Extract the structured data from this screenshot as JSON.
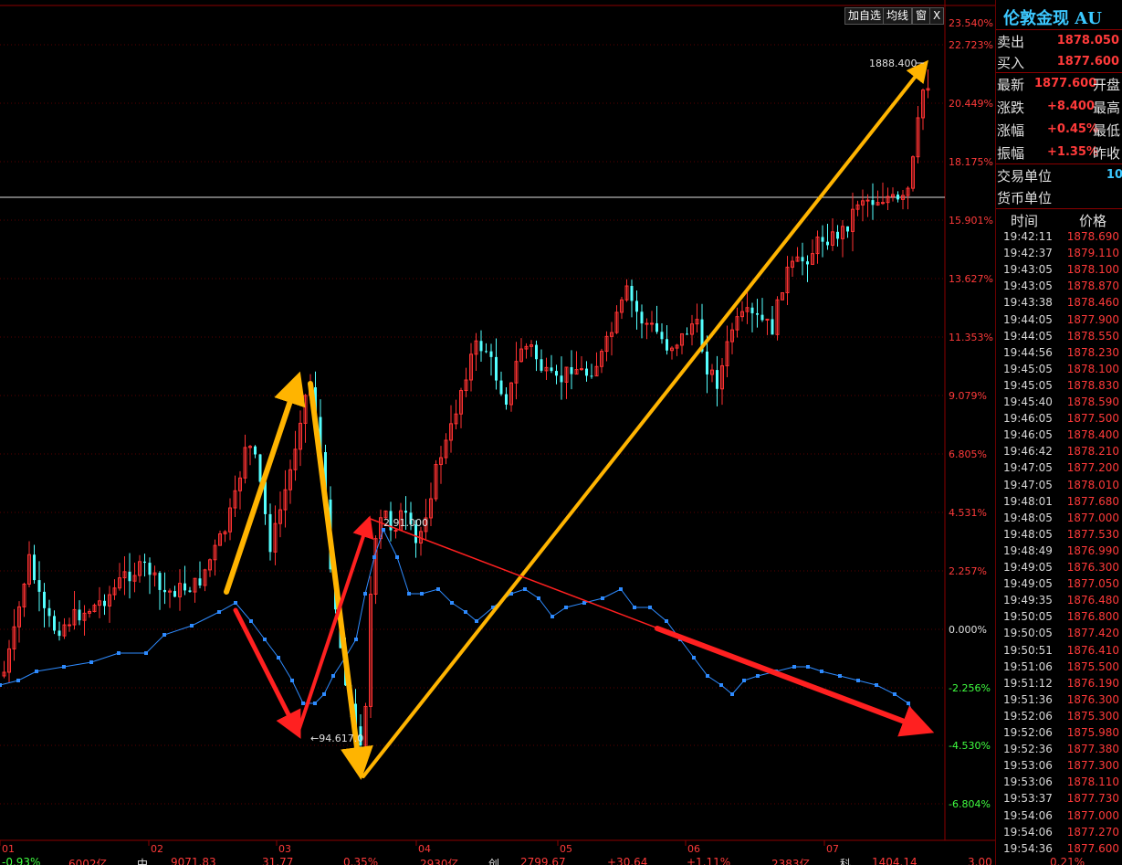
{
  "toolbar": {
    "add_watch": "加自选",
    "ma": "均线",
    "window": "窗",
    "close": "X"
  },
  "instrument": {
    "title": "伦敦金现 AU"
  },
  "quote": {
    "sell_label": "卖出",
    "sell": "1878.050",
    "buy_label": "买入",
    "buy": "1877.600",
    "last_label": "最新",
    "last": "1877.600",
    "open_label": "开盘",
    "change_label": "涨跌",
    "change": "+8.400",
    "high_label": "最高",
    "pct_label": "涨幅",
    "pct": "+0.45%",
    "low_label": "最低",
    "amp_label": "振幅",
    "amp": "+1.35%",
    "prev_label": "昨收",
    "unit_label": "交易单位",
    "unit_value": "10",
    "currency_label": "货币单位"
  },
  "ticks": {
    "time_header": "时间",
    "price_header": "价格",
    "rows": [
      {
        "time": "19:42:11",
        "price": "1878.690"
      },
      {
        "time": "19:42:37",
        "price": "1879.110"
      },
      {
        "time": "19:43:05",
        "price": "1878.100"
      },
      {
        "time": "19:43:05",
        "price": "1878.870"
      },
      {
        "time": "19:43:38",
        "price": "1878.460"
      },
      {
        "time": "19:44:05",
        "price": "1877.900"
      },
      {
        "time": "19:44:05",
        "price": "1878.550"
      },
      {
        "time": "19:44:56",
        "price": "1878.230"
      },
      {
        "time": "19:45:05",
        "price": "1878.100"
      },
      {
        "time": "19:45:05",
        "price": "1878.830"
      },
      {
        "time": "19:45:40",
        "price": "1878.590"
      },
      {
        "time": "19:46:05",
        "price": "1877.500"
      },
      {
        "time": "19:46:05",
        "price": "1878.400"
      },
      {
        "time": "19:46:42",
        "price": "1878.210"
      },
      {
        "time": "19:47:05",
        "price": "1877.200"
      },
      {
        "time": "19:47:05",
        "price": "1878.010"
      },
      {
        "time": "19:48:01",
        "price": "1877.680"
      },
      {
        "time": "19:48:05",
        "price": "1877.000"
      },
      {
        "time": "19:48:05",
        "price": "1877.530"
      },
      {
        "time": "19:48:49",
        "price": "1876.990"
      },
      {
        "time": "19:49:05",
        "price": "1876.300"
      },
      {
        "time": "19:49:05",
        "price": "1877.050"
      },
      {
        "time": "19:49:35",
        "price": "1876.480"
      },
      {
        "time": "19:50:05",
        "price": "1876.800"
      },
      {
        "time": "19:50:05",
        "price": "1877.420"
      },
      {
        "time": "19:50:51",
        "price": "1876.410"
      },
      {
        "time": "19:51:06",
        "price": "1875.500"
      },
      {
        "time": "19:51:12",
        "price": "1876.190"
      },
      {
        "time": "19:51:36",
        "price": "1876.300"
      },
      {
        "time": "19:52:06",
        "price": "1875.300"
      },
      {
        "time": "19:52:06",
        "price": "1875.980"
      },
      {
        "time": "19:52:36",
        "price": "1877.380"
      },
      {
        "time": "19:53:06",
        "price": "1877.300"
      },
      {
        "time": "19:53:06",
        "price": "1878.110"
      },
      {
        "time": "19:53:37",
        "price": "1877.730"
      },
      {
        "time": "19:54:06",
        "price": "1877.000"
      },
      {
        "time": "19:54:06",
        "price": "1877.270"
      },
      {
        "time": "19:54:36",
        "price": "1877.600"
      }
    ]
  },
  "chart": {
    "pct_axis": [
      "23.540%",
      "22.723%",
      "20.449%",
      "18.175%",
      "15.901%",
      "13.627%",
      "11.353%",
      "9.079%",
      "6.805%",
      "4.531%",
      "2.257%",
      "0.000%",
      "-2.256%",
      "-4.530%",
      "-6.804%"
    ],
    "x_labels": [
      "01",
      "02",
      "03",
      "04",
      "05",
      "06",
      "07"
    ],
    "annotations": {
      "high": "1888.400",
      "mid": "←94.617.0",
      "mid2": "2.91.000"
    },
    "colors": {
      "up": "#ff3232",
      "down": "#54ffff",
      "line": "#2e8bff",
      "arrow_yellow": "#ffb400",
      "arrow_red": "#ff2020"
    }
  },
  "bottom": {
    "items": [
      "-0.93%",
      "6002亿",
      "中",
      "9071.83",
      "31.77",
      "0.35%",
      "2930亿",
      "创",
      "2799.67",
      "+30.64",
      "+1.11%",
      "2383亿",
      "科",
      "1404.14",
      "3.00",
      "0.21%"
    ]
  }
}
